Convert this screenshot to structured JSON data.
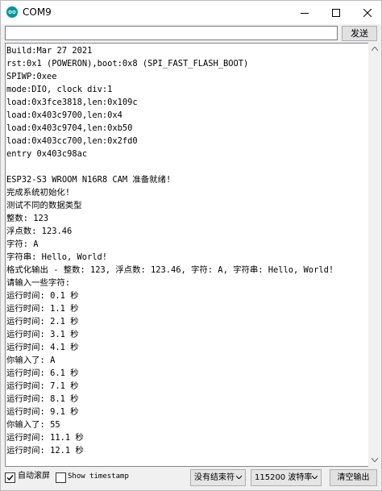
{
  "window": {
    "title": "COM9"
  },
  "send": {
    "input_value": "",
    "button_label": "发送"
  },
  "output": {
    "lines": [
      "Build:Mar 27 2021",
      "rst:0x1 (POWERON),boot:0x8 (SPI_FAST_FLASH_BOOT)",
      "SPIWP:0xee",
      "mode:DIO, clock div:1",
      "load:0x3fce3818,len:0x109c",
      "load:0x403c9700,len:0x4",
      "load:0x403c9704,len:0xb50",
      "load:0x403cc700,len:0x2fd0",
      "entry 0x403c98ac",
      "",
      "ESP32-S3 WROOM N16R8 CAM 准备就绪!",
      "完成系统初始化!",
      "测试不同的数据类型",
      "整数: 123",
      "浮点数: 123.46",
      "字符: A",
      "字符串: Hello, World!",
      "格式化输出 - 整数: 123, 浮点数: 123.46, 字符: A, 字符串: Hello, World!",
      "请输入一些字符:",
      "运行时间: 0.1 秒",
      "运行时间: 1.1 秒",
      "运行时间: 2.1 秒",
      "运行时间: 3.1 秒",
      "运行时间: 4.1 秒",
      "你输入了: A",
      "运行时间: 6.1 秒",
      "运行时间: 7.1 秒",
      "运行时间: 8.1 秒",
      "运行时间: 9.1 秒",
      "你输入了: 55",
      "运行时间: 11.1 秒",
      "运行时间: 12.1 秒"
    ]
  },
  "bottom": {
    "autoscroll_label": "自动滚屏",
    "autoscroll_checked": true,
    "timestamp_label": "Show timestamp",
    "timestamp_checked": false,
    "line_ending": "没有结束符",
    "baud_rate": "115200 波特率",
    "clear_label": "清空输出"
  },
  "colors": {
    "titlebar": "#ffffff",
    "window_bg": "#f0f0f0",
    "app_icon": "#00979c",
    "text": "#000000"
  },
  "icons": {
    "app": "arduino-icon",
    "minimize": "minimize-icon",
    "maximize": "maximize-icon",
    "close": "close-icon",
    "scroll_up": "scroll-up-arrow-icon",
    "scroll_down": "scroll-down-arrow-icon",
    "dropdown": "chevron-down-icon",
    "check": "checkmark-icon"
  }
}
